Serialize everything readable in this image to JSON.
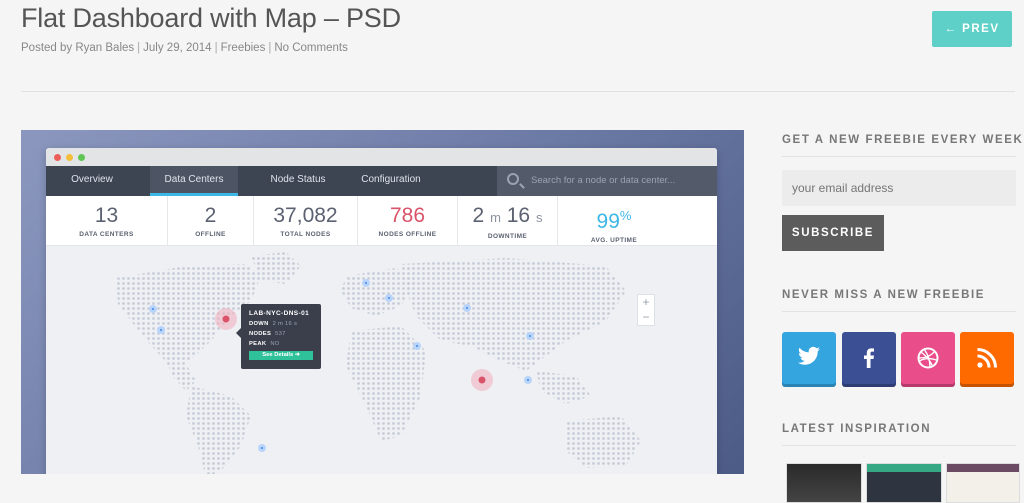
{
  "post": {
    "title": "Flat Dashboard with Map – PSD",
    "meta": {
      "author": "Posted by Ryan Bales",
      "date": "July 29, 2014",
      "category": "Freebies",
      "comments": "No Comments"
    },
    "prev_label": "← PREV"
  },
  "dashboard": {
    "tabs": [
      "Overview",
      "Data Centers",
      "Node Status",
      "Configuration"
    ],
    "active_tab": "Data Centers",
    "search_placeholder": "Search for a node or data center...",
    "stats": [
      {
        "value": "13",
        "label": "DATA CENTERS"
      },
      {
        "value": "2",
        "label": "OFFLINE"
      },
      {
        "value": "37,082",
        "label": "TOTAL NODES"
      },
      {
        "value": "786",
        "label": "NODES OFFLINE",
        "color": "#d9546a"
      },
      {
        "value": "2",
        "unit1": "m",
        "value2": "16",
        "unit2": "s",
        "label": "DOWNTIME"
      },
      {
        "value": "99",
        "unit": "%",
        "label": "AVG. UPTIME",
        "color": "#3db7e5"
      }
    ],
    "zoom": {
      "in": "+",
      "out": "−"
    },
    "tooltip": {
      "title": "LAB-NYC-DNS-01",
      "down_label": "DOWN",
      "down_value": "2 m 16 s",
      "nodes_label": "NODES",
      "nodes_value": "537",
      "peak_label": "PEAK",
      "peak_value": "NO",
      "button": "See Details ➜"
    },
    "colors": {
      "nav": "#3d4452",
      "accent": "#3db7e5",
      "alert": "#d9546a",
      "button": "#2fc19a"
    }
  },
  "sidebar": {
    "freebie_heading": "GET A NEW FREEBIE EVERY WEEK",
    "email_placeholder": "your email address",
    "subscribe": "SUBSCRIBE",
    "social_heading": "NEVER MISS A NEW FREEBIE",
    "social": [
      {
        "name": "twitter-icon",
        "color": "#35a5e0"
      },
      {
        "name": "facebook-icon",
        "color": "#3b4f95"
      },
      {
        "name": "dribbble-icon",
        "color": "#e94e8b"
      },
      {
        "name": "rss-icon",
        "color": "#ff6a00"
      }
    ],
    "inspiration_heading": "LATEST INSPIRATION"
  }
}
